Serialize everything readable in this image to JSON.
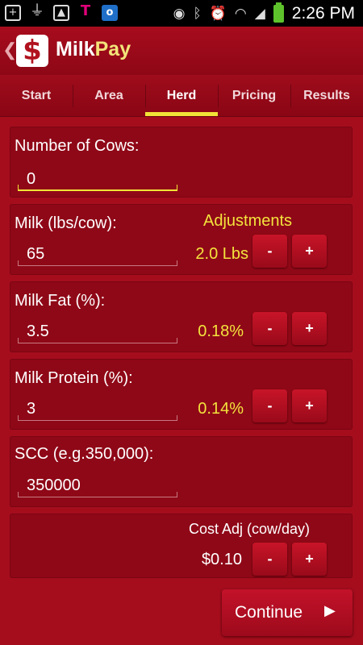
{
  "status_bar": {
    "time": "2:26 PM",
    "left_icons": [
      "add-notification-icon",
      "usb-icon",
      "image-icon",
      "tmobile-icon",
      "outlook-icon"
    ],
    "right_icons": [
      "eye-icon",
      "bluetooth-icon",
      "alarm-icon",
      "wifi-icon",
      "signal-icon",
      "battery-charging-icon"
    ]
  },
  "app": {
    "title_part1": "Milk",
    "title_part2": "Pay",
    "logo_symbol": "$"
  },
  "tabs": [
    {
      "label": "Start",
      "active": false
    },
    {
      "label": "Area",
      "active": false
    },
    {
      "label": "Herd",
      "active": true
    },
    {
      "label": "Pricing",
      "active": false
    },
    {
      "label": "Results",
      "active": false
    }
  ],
  "herd": {
    "cows": {
      "label": "Number of Cows:",
      "value": "0"
    },
    "adjustments_title": "Adjustments",
    "milk": {
      "label": "Milk (lbs/cow):",
      "value": "65",
      "adjust": "2.0 Lbs"
    },
    "fat": {
      "label": "Milk Fat (%):",
      "value": "3.5",
      "adjust": "0.18%"
    },
    "protein": {
      "label": "Milk Protein (%):",
      "value": "3",
      "adjust": "0.14%"
    },
    "scc": {
      "label": "SCC (e.g.350,000):",
      "value": "350000"
    },
    "cost": {
      "label": "Cost Adj (cow/day)",
      "value": "$0.10"
    },
    "minus_label": "-",
    "plus_label": "+"
  },
  "continue": {
    "label": "Continue",
    "arrow": "▶"
  },
  "colors": {
    "background": "#a50d1d",
    "accent_yellow": "#f2e337",
    "button_red": "#c81428"
  }
}
